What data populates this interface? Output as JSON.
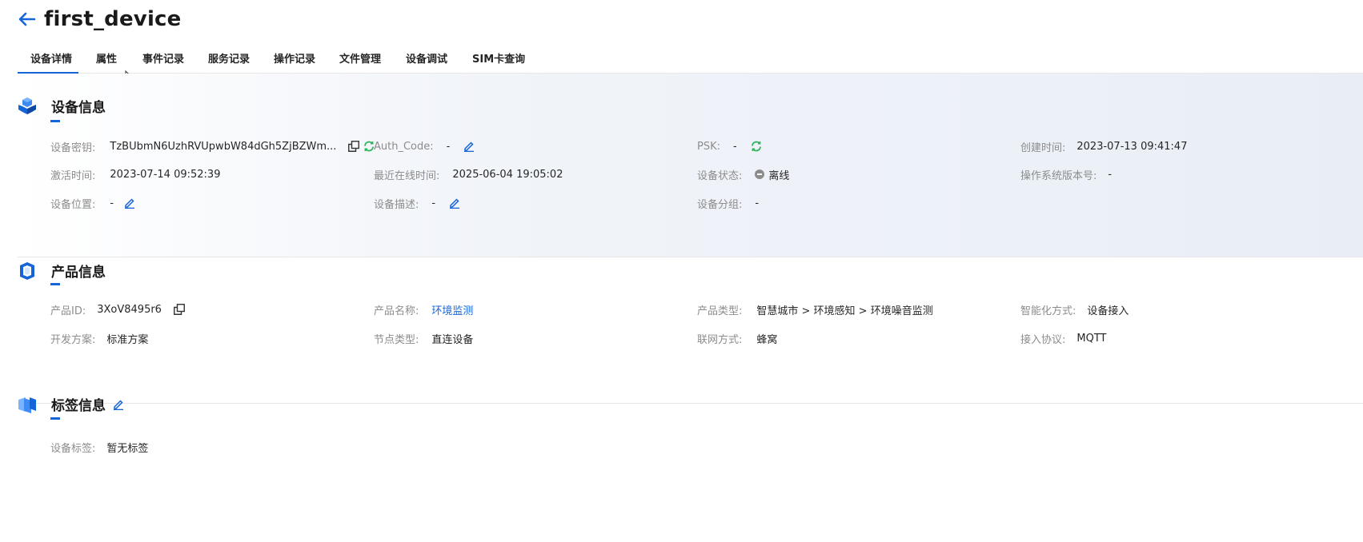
{
  "header": {
    "back_icon": "arrow-left-icon",
    "title": "first_device"
  },
  "tabs": [
    {
      "label": "设备详情",
      "active": true
    },
    {
      "label": "属性"
    },
    {
      "label": "事件记录"
    },
    {
      "label": "服务记录"
    },
    {
      "label": "操作记录"
    },
    {
      "label": "文件管理"
    },
    {
      "label": "设备调试"
    },
    {
      "label": "SIM卡查询"
    }
  ],
  "device_info": {
    "title": "设备信息",
    "icon": "cubes-icon",
    "fields": {
      "device_key": {
        "label": "设备密钥:",
        "value": "TzBUbmN6UzhRVUpwbW84dGh5ZjBZWm..."
      },
      "auth_code": {
        "label": "Auth_Code:",
        "value": "-"
      },
      "psk": {
        "label": "PSK:",
        "value": "-"
      },
      "created": {
        "label": "创建时间:",
        "value": "2023-07-13 09:41:47"
      },
      "activated": {
        "label": "激活时间:",
        "value": "2023-07-14 09:52:39"
      },
      "last_online": {
        "label": "最近在线时间:",
        "value": "2025-06-04 19:05:02"
      },
      "status": {
        "label": "设备状态:",
        "value": "离线"
      },
      "os_version": {
        "label": "操作系统版本号:",
        "value": "-"
      },
      "location": {
        "label": "设备位置:",
        "value": "-"
      },
      "description": {
        "label": "设备描述:",
        "value": "-"
      },
      "group": {
        "label": "设备分组:",
        "value": "-"
      }
    }
  },
  "product_info": {
    "title": "产品信息",
    "icon": "box-icon",
    "fields": {
      "product_id": {
        "label": "产品ID:",
        "value": "3XoV8495r6"
      },
      "product_name": {
        "label": "产品名称:",
        "value": "环境监测"
      },
      "product_type": {
        "label": "产品类型:",
        "value": "智慧城市 > 环境感知 > 环境噪音监测"
      },
      "smart_mode": {
        "label": "智能化方式:",
        "value": "设备接入"
      },
      "dev_plan": {
        "label": "开发方案:",
        "value": "标准方案"
      },
      "node_type": {
        "label": "节点类型:",
        "value": "直连设备"
      },
      "network": {
        "label": "联网方式:",
        "value": "蜂窝"
      },
      "protocol": {
        "label": "接入协议:",
        "value": "MQTT"
      }
    }
  },
  "tag_info": {
    "title": "标签信息",
    "icon": "tag-icon",
    "fields": {
      "tags": {
        "label": "设备标签:",
        "value": "暂无标签"
      }
    }
  },
  "colors": {
    "accent": "#1665d8",
    "refresh": "#2db55d",
    "label": "#8c8c8c",
    "offline": "#8c8c8c"
  }
}
